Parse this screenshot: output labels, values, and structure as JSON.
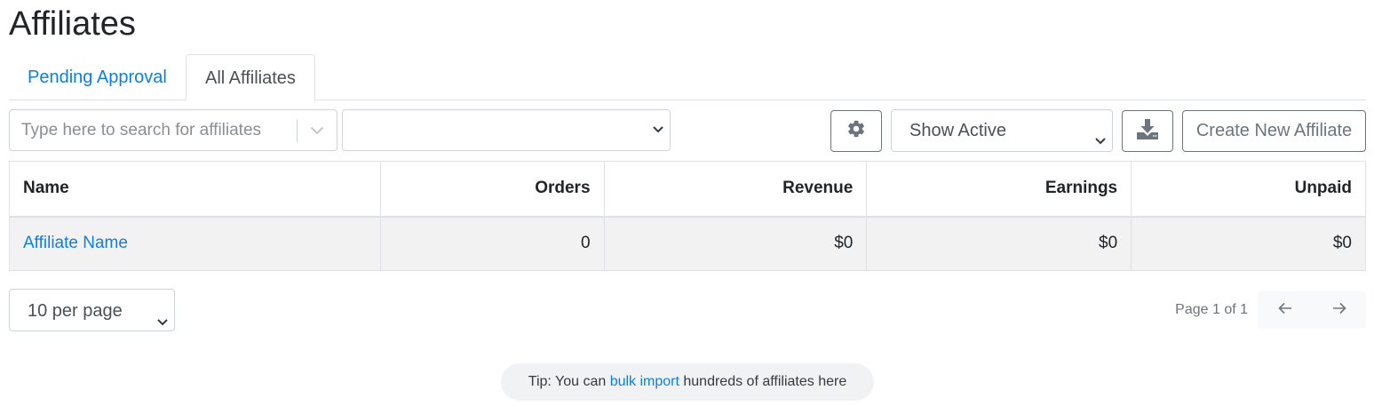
{
  "page": {
    "title": "Affiliates"
  },
  "tabs": [
    {
      "label": "Pending Approval",
      "active": false
    },
    {
      "label": "All Affiliates",
      "active": true
    }
  ],
  "toolbar": {
    "search_placeholder": "Type here to search for affiliates",
    "search_value": "",
    "filter_value": "",
    "settings_icon": "gear-icon",
    "status_filter": "Show Active",
    "download_icon": "download-icon",
    "create_button": "Create New Affiliate"
  },
  "table": {
    "columns": [
      "Name",
      "Orders",
      "Revenue",
      "Earnings",
      "Unpaid"
    ],
    "rows": [
      {
        "name": "Affiliate Name",
        "orders": "0",
        "revenue": "$0",
        "earnings": "$0",
        "unpaid": "$0"
      }
    ]
  },
  "pagination": {
    "per_page": "10 per page",
    "page_info": "Page 1 of 1",
    "prev_icon": "arrow-left-icon",
    "next_icon": "arrow-right-icon"
  },
  "tip": {
    "prefix": "Tip: You can ",
    "link": "bulk import",
    "suffix": " hundreds of affiliates here"
  },
  "colors": {
    "link": "#0d7fe3",
    "border": "#dee2e6",
    "row_bg": "#f2f2f2",
    "muted": "#6c757d"
  }
}
